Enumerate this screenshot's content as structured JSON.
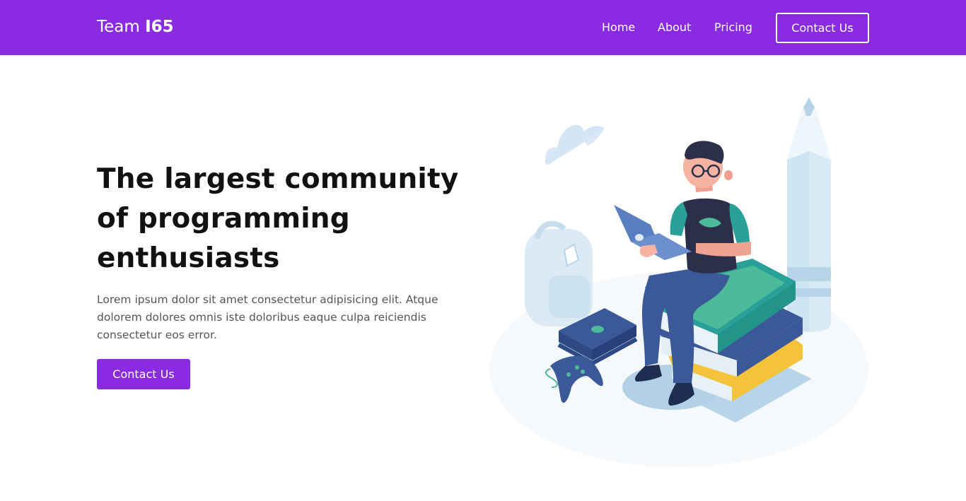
{
  "nav": {
    "brand_light": "Team ",
    "brand_bold": "I65",
    "links": [
      "Home",
      "About",
      "Pricing"
    ],
    "cta": "Contact Us"
  },
  "hero": {
    "title": "The largest community of programming enthusiasts",
    "text": "Lorem ipsum dolor sit amet consectetur adipisicing elit. Atque dolorem dolores omnis iste doloribus eaque culpa reiciendis consectetur eos error.",
    "cta": "Contact Us"
  },
  "colors": {
    "primary": "#8a2be2",
    "white": "#ffffff",
    "heading": "#111111",
    "body_text": "#555555"
  },
  "illustration": {
    "icons": [
      "cloud-icon",
      "backpack-icon",
      "game-console-icon",
      "gamepad-icon",
      "books-stack-icon",
      "pencil-icon",
      "person-with-laptop-icon"
    ]
  }
}
